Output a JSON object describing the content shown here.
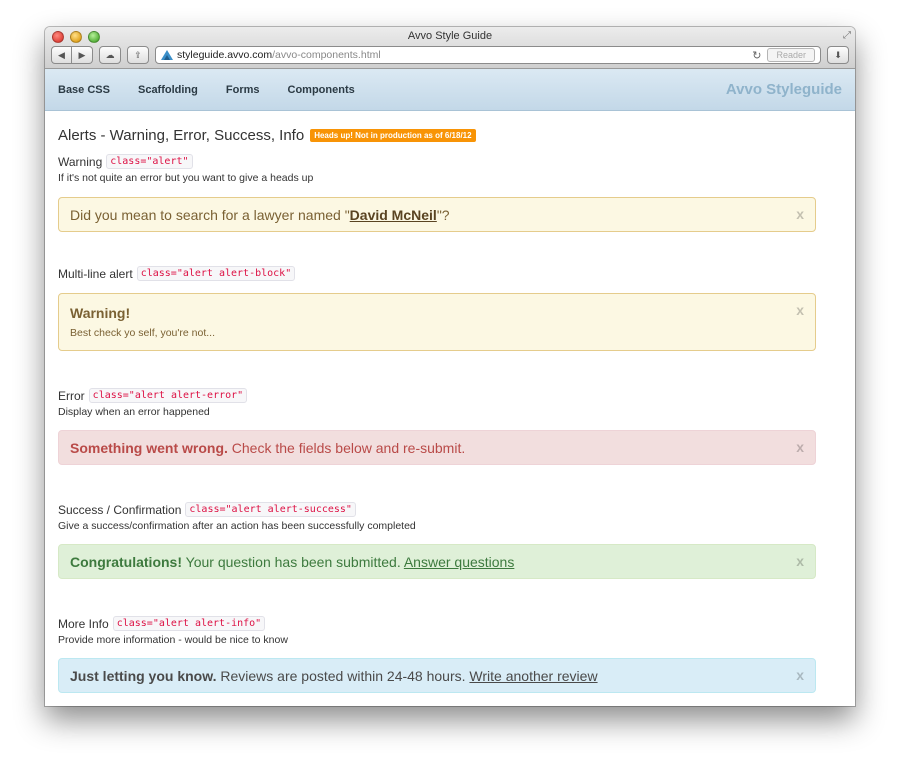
{
  "window": {
    "title": "Avvo Style Guide",
    "address_host": "styleguide.avvo.com",
    "address_path": "/avvo-components.html",
    "reader_label": "Reader",
    "reload_glyph": "↻",
    "fullscreen_glyph": "⤢",
    "share_glyph": "⇪",
    "download_glyph": "⬇",
    "back_glyph": "◀",
    "forward_glyph": "▶",
    "cloud_glyph": "☁"
  },
  "navbar": {
    "links": [
      "Base CSS",
      "Scaffolding",
      "Forms",
      "Components"
    ],
    "brand": "Avvo Styleguide"
  },
  "page": {
    "title": "Alerts - Warning, Error, Success, Info",
    "badge": "Heads up! Not in production as of 6/18/12"
  },
  "sections": {
    "warning": {
      "label": "Warning",
      "code": "class=\"alert\"",
      "desc": "If it's not quite an error but you want to give a heads up",
      "alert_prefix": "Did you mean to search for a lawyer named \"",
      "alert_link": "David McNeil",
      "alert_suffix": "\"?"
    },
    "multiline": {
      "label": "Multi-line alert",
      "code": "class=\"alert alert-block\"",
      "alert_title": "Warning!",
      "alert_body": "Best check yo self, you're not..."
    },
    "error": {
      "label": "Error",
      "code": "class=\"alert alert-error\"",
      "desc": "Display when an error happened",
      "alert_strong": "Something went wrong.",
      "alert_text": " Check the fields below and re-submit."
    },
    "success": {
      "label": "Success / Confirmation",
      "code": "class=\"alert alert-success\"",
      "desc": "Give a success/confirmation after an action has been successfully completed",
      "alert_strong": "Congratulations!",
      "alert_text": " Your question has been submitted. ",
      "alert_link": "Answer questions"
    },
    "info": {
      "label": "More Info",
      "code": "class=\"alert alert-info\"",
      "desc": "Provide more information - would be nice to know",
      "alert_strong": "Just letting you know.",
      "alert_text": " Reviews are posted within 24-48 hours. ",
      "alert_link": "Write another review"
    }
  },
  "close_glyph": "x",
  "colors": {
    "badge": "#f89406",
    "warning_bg": "#fcf8e3",
    "error_bg": "#f2dede",
    "success_bg": "#dff0d8",
    "info_bg": "#d9edf7",
    "brand": "#8fb3cb"
  }
}
